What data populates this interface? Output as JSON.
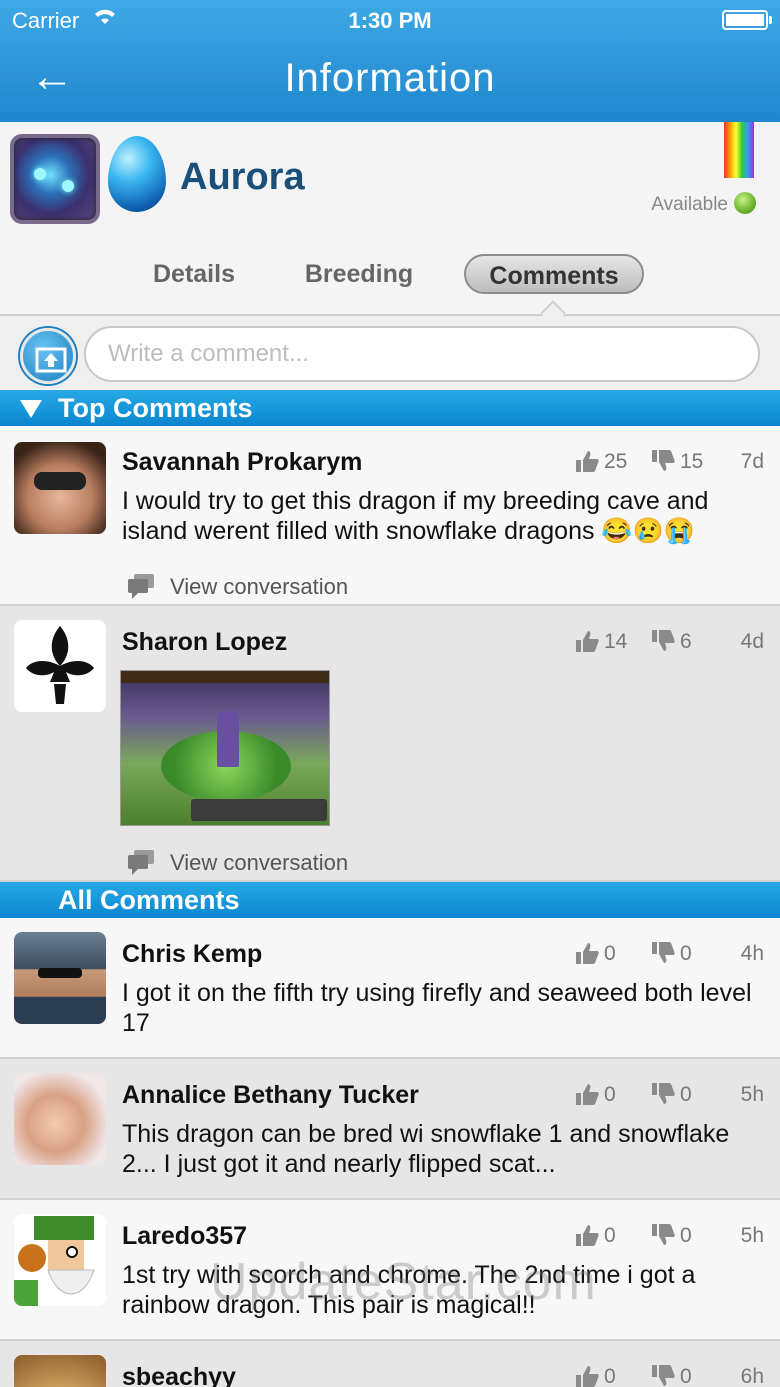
{
  "status_bar": {
    "carrier": "Carrier",
    "time": "1:30 PM"
  },
  "nav": {
    "back_label": "←",
    "title": "Information"
  },
  "dragon": {
    "name": "Aurora",
    "availability": "Available"
  },
  "tabs": [
    {
      "label": "Details",
      "selected": false
    },
    {
      "label": "Breeding",
      "selected": false
    },
    {
      "label": "Comments",
      "selected": true
    }
  ],
  "compose": {
    "placeholder": "Write a comment..."
  },
  "sections": {
    "top": "Top Comments",
    "all": "All Comments"
  },
  "top_comments": [
    {
      "name": "Savannah Prokarym",
      "up": "25",
      "down": "15",
      "age": "7d",
      "text": "I would try to get this dragon if my breeding cave and island werent filled with snowflake dragons 😂😢😭",
      "view_conversation": "View conversation"
    },
    {
      "name": "Sharon Lopez",
      "up": "14",
      "down": "6",
      "age": "4d",
      "text": "",
      "view_conversation": "View conversation"
    }
  ],
  "all_comments": [
    {
      "name": "Chris Kemp",
      "up": "0",
      "down": "0",
      "age": "4h",
      "text": "I got it on the fifth try using firefly and seaweed both level 17"
    },
    {
      "name": "Annalice Bethany Tucker",
      "up": "0",
      "down": "0",
      "age": "5h",
      "text": "This dragon can be bred wi snowflake 1 and snowflake 2... I just got it and nearly flipped scat..."
    },
    {
      "name": "Laredo357",
      "up": "0",
      "down": "0",
      "age": "5h",
      "text": "1st try with scorch and chrome. The 2nd time i got a rainbow dragon. This pair is magical!!"
    },
    {
      "name": "sbeachyy",
      "up": "0",
      "down": "0",
      "age": "6h",
      "text": ""
    }
  ],
  "watermark": "UpdateStar.com",
  "colors": {
    "nav_blue": "#1f86cc",
    "section_blue": "#0b86cf",
    "name_blue": "#1a4f7a",
    "available_green": "#6bb42b"
  },
  "icons": {
    "upload": "upload-image-icon",
    "thumb_up": "thumb-up-icon",
    "thumb_down": "thumb-down-icon",
    "conversation": "speech-bubble-icon"
  }
}
